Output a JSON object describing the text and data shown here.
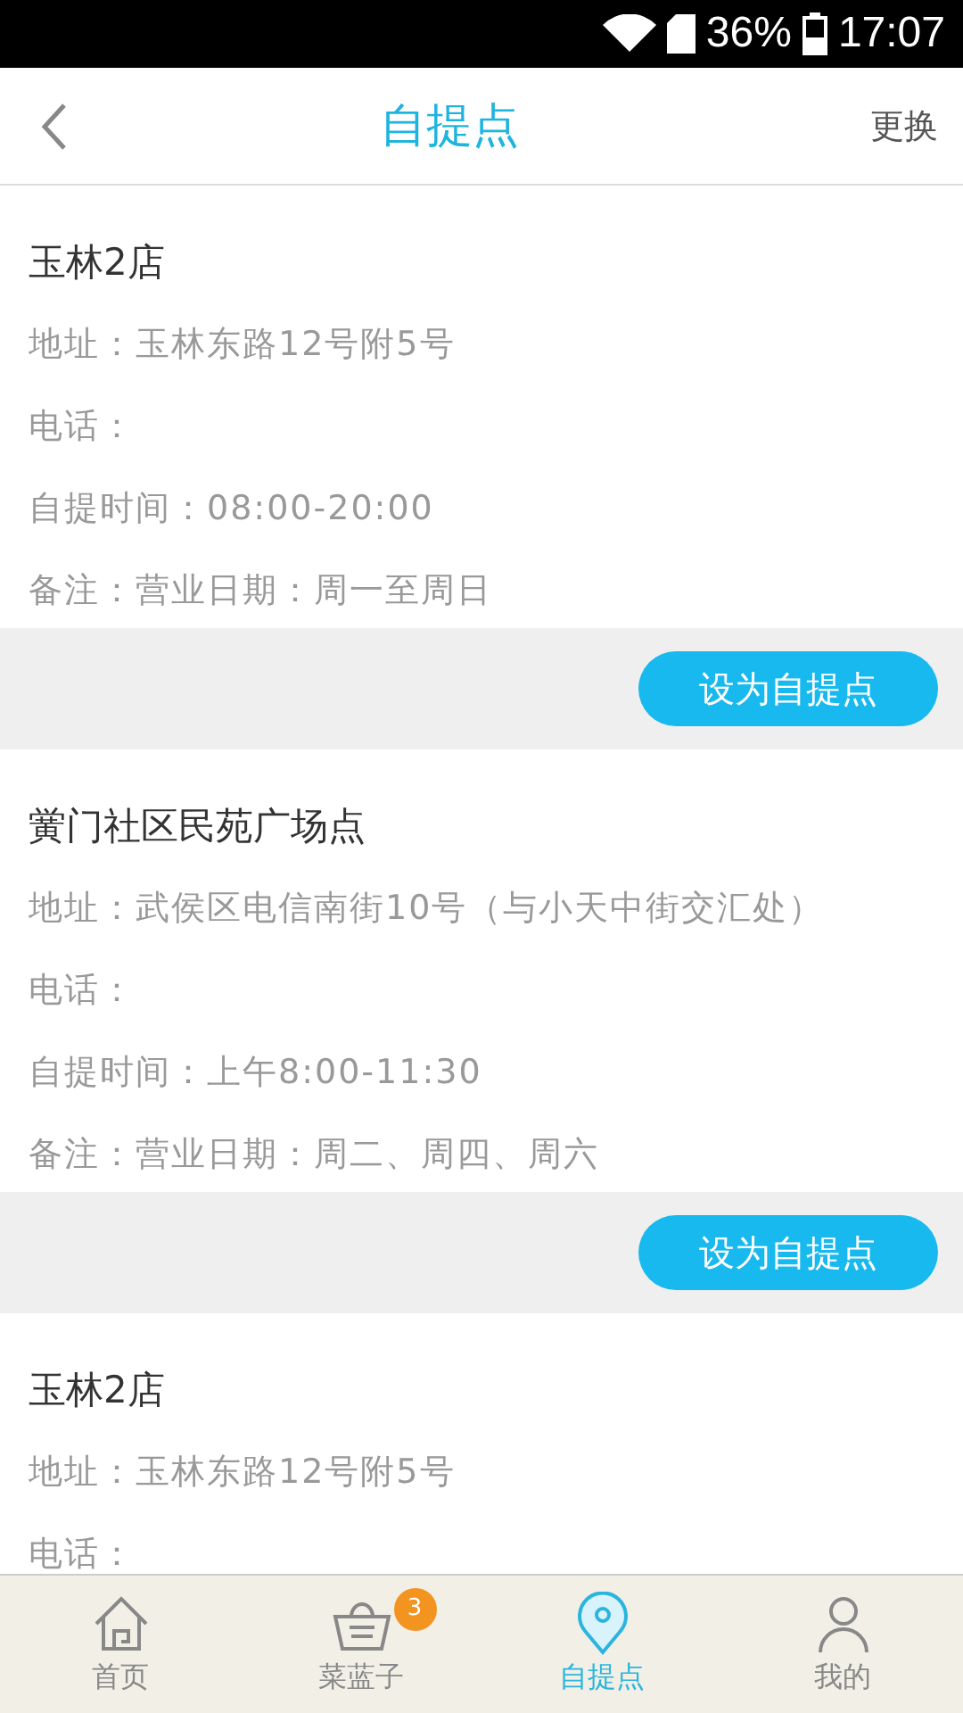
{
  "status_bar": {
    "battery": "36%",
    "time": "17:07"
  },
  "header": {
    "title": "自提点",
    "action": "更换"
  },
  "stores": [
    {
      "name": "玉林2店",
      "address": "地址：玉林东路12号附5号",
      "phone": "电话：",
      "hours": "自提时间：08:00-20:00",
      "note": "备注：营业日期：周一至周日",
      "button": "设为自提点"
    },
    {
      "name": "黉门社区民苑广场点",
      "address": "地址：武侯区电信南街10号（与小天中街交汇处）",
      "phone": "电话：",
      "hours": "自提时间：上午8:00-11:30",
      "note": "备注：营业日期：周二、周四、周六",
      "button": "设为自提点"
    },
    {
      "name": "玉林2店",
      "address": "地址：玉林东路12号附5号",
      "phone": "电话："
    }
  ],
  "tab_bar": [
    {
      "kind": "home",
      "label": "首页",
      "selected": false
    },
    {
      "kind": "basket",
      "label": "菜蓝子",
      "selected": false,
      "badge": "3"
    },
    {
      "kind": "pin",
      "label": "自提点",
      "selected": true
    },
    {
      "kind": "user",
      "label": "我的",
      "selected": false
    }
  ]
}
